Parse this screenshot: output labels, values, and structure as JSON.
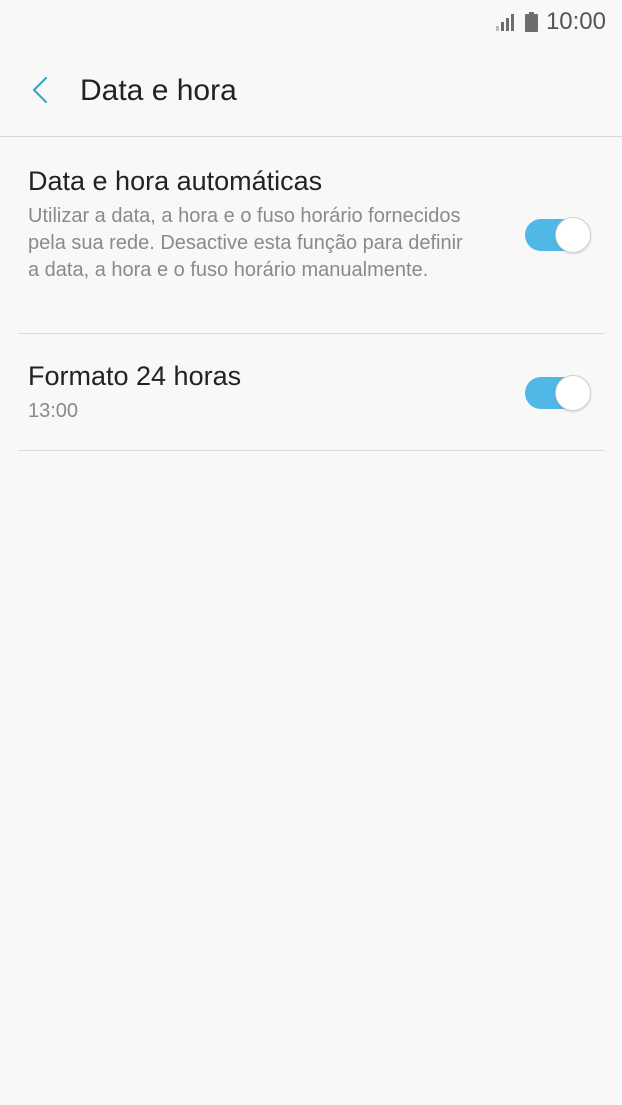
{
  "status_bar": {
    "time": "10:00",
    "icons": [
      "signal-icon",
      "battery-icon"
    ]
  },
  "header": {
    "back_icon": "chevron-left-icon",
    "title": "Data e hora"
  },
  "settings": {
    "auto_datetime": {
      "title": "Data e hora automáticas",
      "description": "Utilizar a data, a hora e o fuso horário fornecidos pela sua rede. Desactive esta função para definir a data, a hora e o fuso horário manualmente.",
      "enabled": true
    },
    "format_24h": {
      "title": "Formato 24 horas",
      "subtitle": "13:00",
      "enabled": true
    }
  },
  "colors": {
    "accent": "#4fb8e6",
    "back_chevron": "#3aa8c4",
    "background": "#f8f8f8",
    "secondary_text": "#8a8a8a"
  }
}
